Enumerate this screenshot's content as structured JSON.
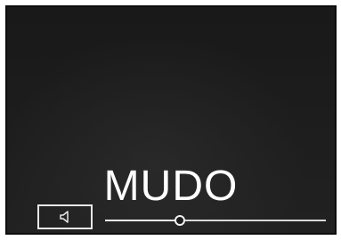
{
  "display": {
    "status_text": "MUDO"
  },
  "volume": {
    "icon": "speaker-icon",
    "level": 0.34
  },
  "colors": {
    "screen_background": "#1d1d1d",
    "foreground": "#ffffff"
  }
}
